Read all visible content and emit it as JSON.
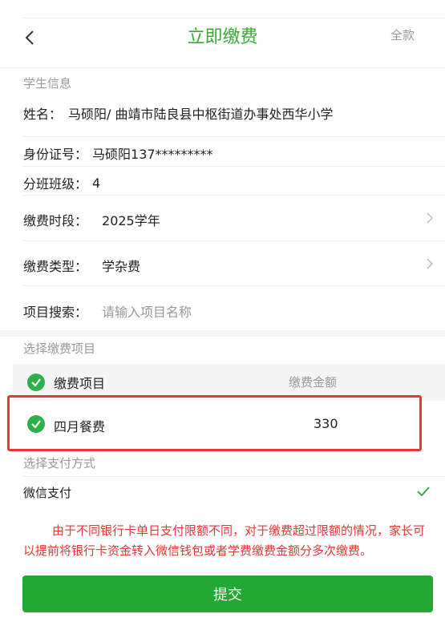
{
  "header": {
    "title": "立即缴费",
    "right_action": "全款"
  },
  "student_section": {
    "label": "学生信息"
  },
  "student": {
    "name_label": "姓名：",
    "name_value": "马硕阳/ 曲靖市陆良县中枢街道办事处西华小学",
    "id_label": "身份证号：",
    "id_value": "马硕阳137*********",
    "class_label": "分班班级：",
    "class_value": "4"
  },
  "fields": {
    "period_label": "缴费时段：",
    "period_value": "2025学年",
    "type_label": "缴费类型：",
    "type_value": "学杂费",
    "search_label": "项目搜索：",
    "search_placeholder": "请输入项目名称"
  },
  "items_section": {
    "label": "选择缴费项目"
  },
  "items_table": {
    "col_item": "缴费项目",
    "col_amount": "缴费金额",
    "rows": [
      {
        "name": "四月餐费",
        "amount": "330",
        "checked": true
      }
    ]
  },
  "payment": {
    "label": "选择支付方式",
    "method": "微信支付",
    "selected": true
  },
  "notice": "由于不同银行卡单日支付限额不同，对于缴费超过限额的情况，家长可以提前将银行卡资金转入微信钱包或者学费缴费金额分多次缴费。",
  "submit_label": "提交",
  "colors": {
    "accent": "#24a834",
    "title": "#3aaa35",
    "warning": "#e53935",
    "muted": "#999999"
  }
}
